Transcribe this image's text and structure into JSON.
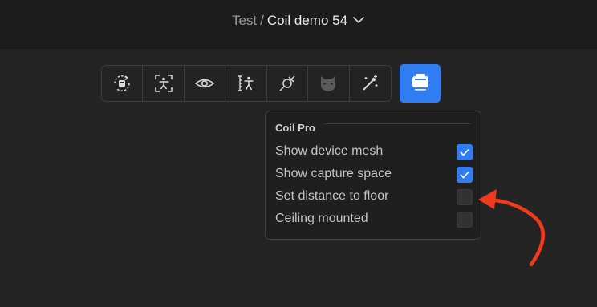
{
  "header": {
    "parent": "Test",
    "separator": "/",
    "current": "Coil demo 54",
    "dropdown_icon": "chevron-down-icon"
  },
  "toolbar": {
    "tools": [
      {
        "name": "rotate-device-icon"
      },
      {
        "name": "body-tracking-icon"
      },
      {
        "name": "visibility-eye-icon"
      },
      {
        "name": "height-measure-icon"
      },
      {
        "name": "link-plug-icon"
      },
      {
        "name": "mask-icon"
      },
      {
        "name": "magic-wand-icon"
      }
    ],
    "active_tool": {
      "name": "coil-device-icon"
    }
  },
  "panel": {
    "title": "Coil Pro",
    "options": [
      {
        "label": "Show device mesh",
        "checked": true
      },
      {
        "label": "Show capture space",
        "checked": true
      },
      {
        "label": "Set distance to floor",
        "checked": false
      },
      {
        "label": "Ceiling mounted",
        "checked": false
      }
    ]
  },
  "annotation": {
    "arrow_color": "#f03a1c"
  },
  "colors": {
    "accent": "#2f7df0",
    "background": "#242424",
    "topbar": "#1c1c1c"
  }
}
